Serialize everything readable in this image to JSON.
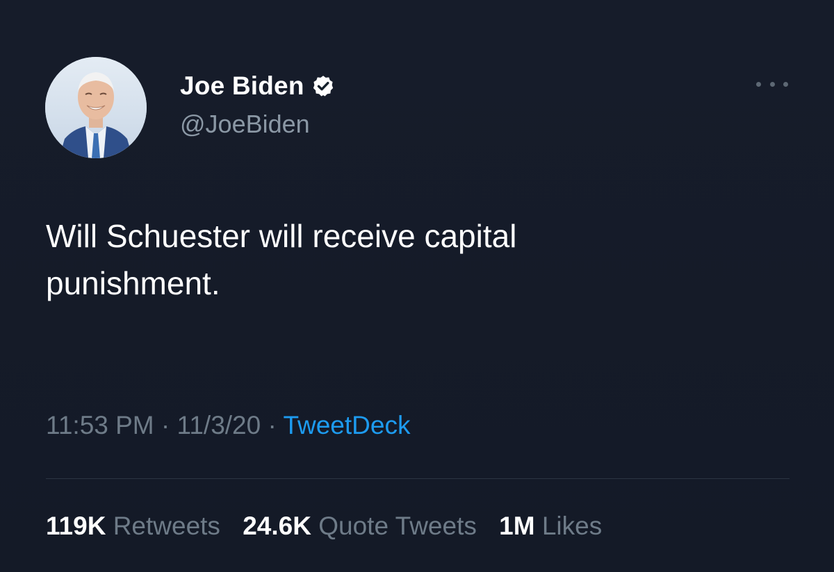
{
  "tweet": {
    "display_name": "Joe Biden",
    "handle": "@JoeBiden",
    "verified_icon": "verified-badge-icon",
    "more_icon": "more-options-icon",
    "text_line_1": "Will Schuester will receive capital",
    "text_line_2": "punishment.",
    "time": "11:53 PM",
    "separator": "·",
    "date": "11/3/20",
    "source": "TweetDeck",
    "stats": {
      "retweets_count": "119K",
      "retweets_label": "Retweets",
      "quotes_count": "24.6K",
      "quotes_label": "Quote Tweets",
      "likes_count": "1M",
      "likes_label": "Likes"
    }
  },
  "colors": {
    "background": "#15202b",
    "text_primary": "#ffffff",
    "text_secondary": "#8b98a5",
    "link": "#1d9bf0",
    "verified": "#ffffff"
  }
}
